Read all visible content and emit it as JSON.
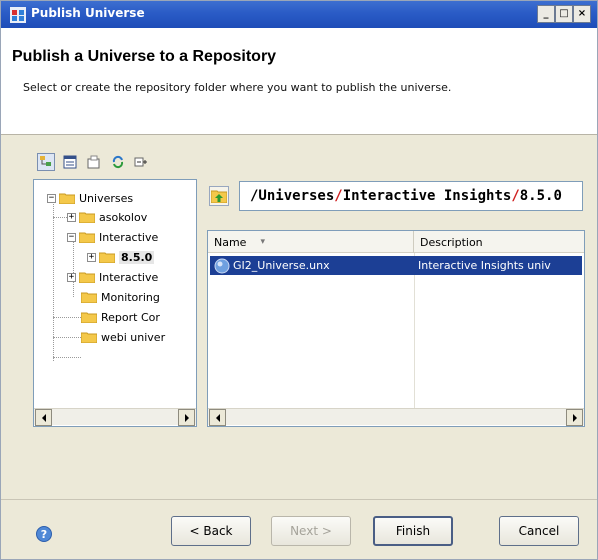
{
  "window": {
    "title": "Publish Universe",
    "controls": [
      "_",
      "□",
      "×"
    ]
  },
  "header": {
    "heading": "Publish a Universe to a Repository",
    "description": "Select or create the repository folder where you want to publish the universe."
  },
  "toolbar": {
    "icons": [
      "hierarchy-icon",
      "details-view-icon",
      "new-folder-icon",
      "refresh-icon",
      "expand-collapse-icon"
    ]
  },
  "tree": {
    "root": "Universes",
    "items": [
      {
        "label": "asokolov",
        "expander": "+"
      },
      {
        "label": "Interactive",
        "expander": "−"
      },
      {
        "label": "8.5.0",
        "expander": "+"
      },
      {
        "label": "Interactive",
        "expander": "+"
      },
      {
        "label": "Monitoring",
        "expander": ""
      },
      {
        "label": "Report Cor",
        "expander": ""
      },
      {
        "label": "webi univer",
        "expander": ""
      }
    ],
    "root_expander": "−"
  },
  "path": {
    "parts": [
      "/Universes",
      "/Interactive Insights",
      "/8.5.0"
    ]
  },
  "list": {
    "columns": [
      "Name",
      "Description"
    ],
    "sort_indicator": "▾",
    "rows": [
      {
        "name": "GI2_Universe.unx",
        "description": "Interactive Insights univ"
      }
    ]
  },
  "buttons": {
    "back": "< Back",
    "next": "Next >",
    "finish": "Finish",
    "cancel": "Cancel"
  },
  "colors": {
    "titlebar": "#2a5bc6",
    "selection": "#1c3f95",
    "path_separator": "#d02020",
    "folder": "#f4c84a"
  }
}
